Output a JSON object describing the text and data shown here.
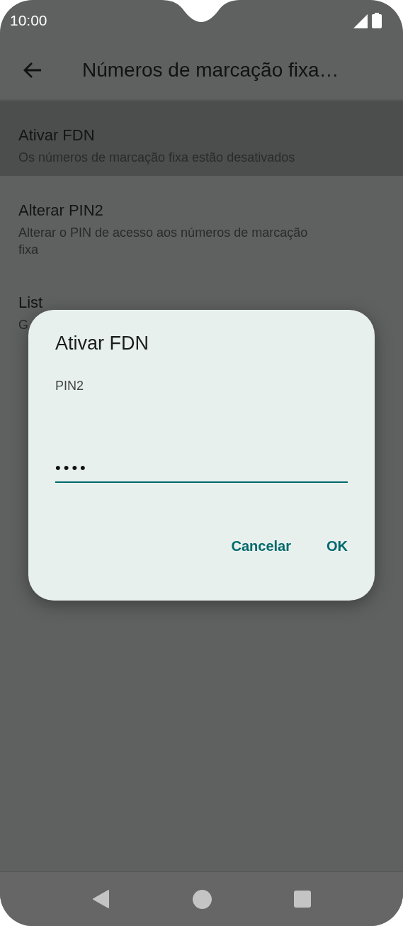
{
  "status_bar": {
    "time": "10:00"
  },
  "app_bar": {
    "title": "Números de marcação fixa…"
  },
  "items": [
    {
      "title": "Ativar FDN",
      "subtitle": "Os números de marcação fixa estão desativados",
      "selected": true
    },
    {
      "title": "Alterar PIN2",
      "subtitle": "Alterar o PIN de acesso aos números de marcação fixa",
      "selected": false
    },
    {
      "title": "List",
      "subtitle": "G",
      "selected": false
    }
  ],
  "dialog": {
    "title": "Ativar FDN",
    "field_label": "PIN2",
    "value": "••••",
    "buttons": [
      "Cancelar",
      "OK"
    ]
  }
}
